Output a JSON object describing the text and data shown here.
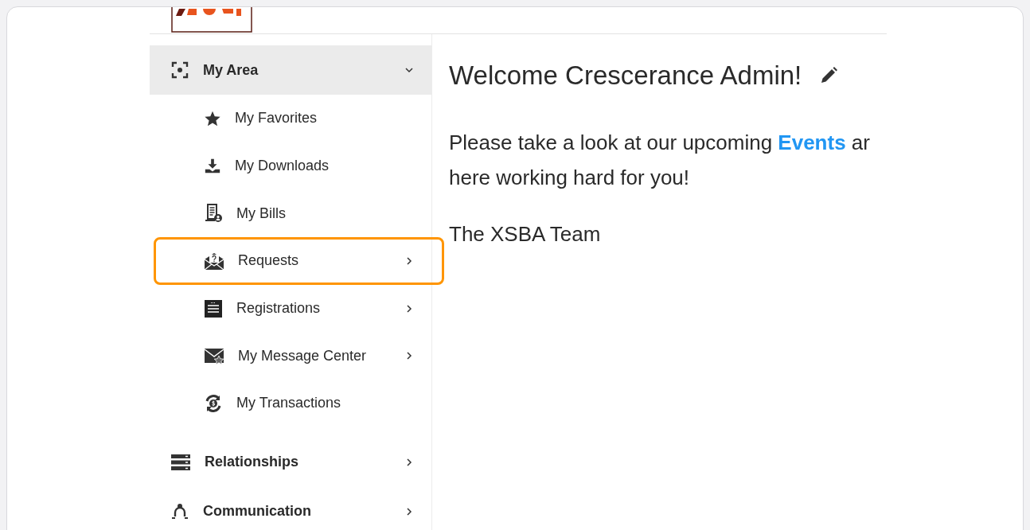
{
  "sidebar": {
    "section": {
      "label": "My Area",
      "expanded": true,
      "kind": "focus"
    },
    "items": [
      {
        "label": "My Favorites",
        "kind": "star",
        "has_submenu": false,
        "selected": false
      },
      {
        "label": "My Downloads",
        "kind": "download",
        "has_submenu": false,
        "selected": false
      },
      {
        "label": "My Bills",
        "kind": "bill",
        "has_submenu": false,
        "selected": false
      },
      {
        "label": "Requests",
        "kind": "envelope-question",
        "has_submenu": true,
        "selected": true
      },
      {
        "label": "Registrations",
        "kind": "list",
        "has_submenu": true,
        "selected": false
      },
      {
        "label": "My Message Center",
        "kind": "envelope-star",
        "has_submenu": true,
        "selected": false
      },
      {
        "label": "My Transactions",
        "kind": "money-cycle",
        "has_submenu": false,
        "selected": false
      }
    ],
    "sections": [
      {
        "label": "Relationships",
        "kind": "servers",
        "expanded": false
      },
      {
        "label": "Communication",
        "kind": "people",
        "expanded": false
      }
    ]
  },
  "content": {
    "heading": "Welcome Crescerance Admin!",
    "paragraph": {
      "before": "Please take a look at our upcoming ",
      "link": "Events",
      "after": "ar",
      "line_2": "here working hard for you!"
    },
    "signature": "The XSBA Team"
  }
}
